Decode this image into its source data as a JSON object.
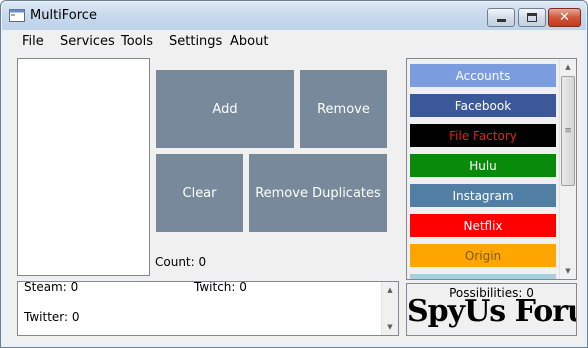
{
  "window": {
    "title": "MultiForce"
  },
  "menu": [
    "File",
    "Services",
    "Tools",
    "Settings",
    "About"
  ],
  "actions": {
    "add": "Add",
    "remove": "Remove",
    "clear": "Clear",
    "remove_duplicates": "Remove Duplicates"
  },
  "count_label": "Count: 0",
  "services": [
    {
      "label": "Accounts",
      "bg": "#7b9ddf",
      "fg": "#ffffff"
    },
    {
      "label": "Facebook",
      "bg": "#3b5998",
      "fg": "#ffffff"
    },
    {
      "label": "File Factory",
      "bg": "#000000",
      "fg": "#e0241b"
    },
    {
      "label": "Hulu",
      "bg": "#0a8a0a",
      "fg": "#ffffff"
    },
    {
      "label": "Instagram",
      "bg": "#517fa4",
      "fg": "#ffffff"
    },
    {
      "label": "Netflix",
      "bg": "#ff0000",
      "fg": "#ffffff"
    },
    {
      "label": "Origin",
      "bg": "#ffa500",
      "fg": "#7a5a1a"
    },
    {
      "label": "",
      "bg": "#a8cfe0",
      "fg": "#ffffff"
    }
  ],
  "stats": {
    "steam": "Steam: 0",
    "twitch": "Twitch: 0",
    "twitter": "Twitter: 0"
  },
  "possibilities": "Possibilities: 0",
  "watermark": "SpyUs Forum",
  "icons": {
    "app": "app-window-icon",
    "minimize": "minimize-icon",
    "maximize": "maximize-icon",
    "close": "close-icon"
  }
}
